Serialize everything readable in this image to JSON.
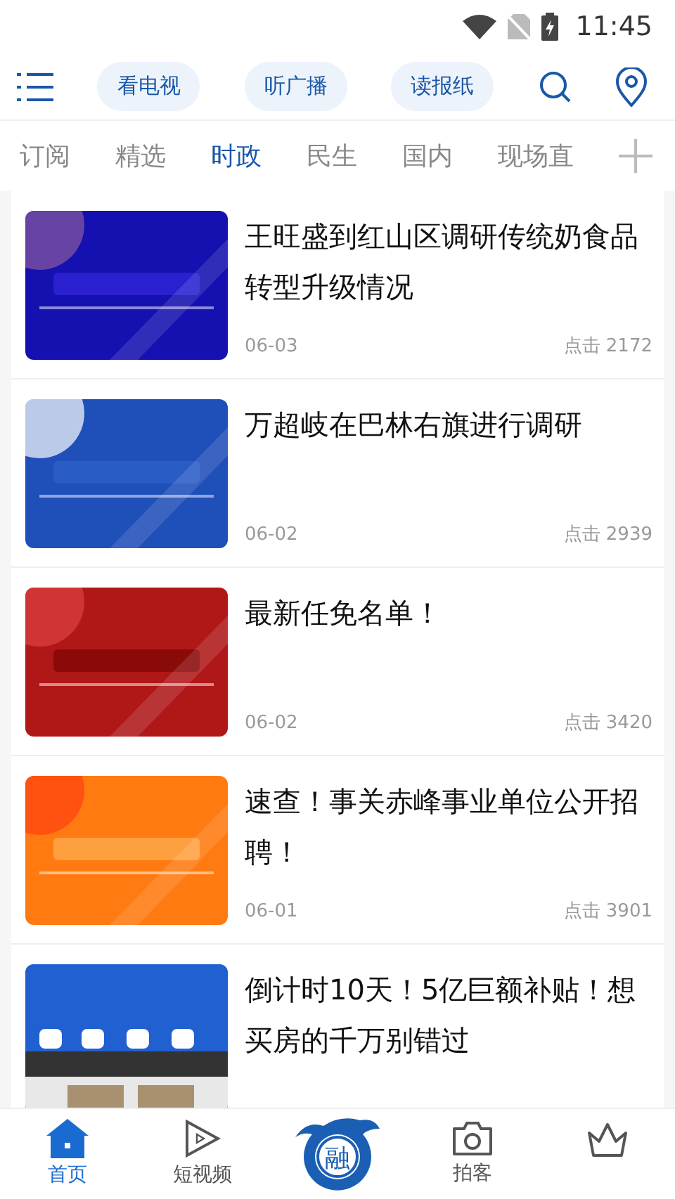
{
  "status_bar": {
    "time": "11:45"
  },
  "header": {
    "pills": [
      "看电视",
      "听广播",
      "读报纸"
    ]
  },
  "channels": [
    {
      "label": "订阅",
      "selected": false
    },
    {
      "label": "精选",
      "selected": false
    },
    {
      "label": "时政",
      "selected": true
    },
    {
      "label": "民生",
      "selected": false
    },
    {
      "label": "国内",
      "selected": false
    },
    {
      "label": "现场直",
      "selected": false
    }
  ],
  "articles": [
    {
      "title": "王旺盛到红山区调研传统奶食品转型升级情况",
      "date": "06-03",
      "clicks": "点击 2172"
    },
    {
      "title": "万超岐在巴林右旗进行调研",
      "date": "06-02",
      "clicks": "点击 2939"
    },
    {
      "title": "最新任免名单！",
      "date": "06-02",
      "clicks": "点击 3420"
    },
    {
      "title": "速查！事关赤峰事业单位公开招聘！",
      "date": "06-01",
      "clicks": "点击 3901"
    },
    {
      "title": "倒计时10天！5亿巨额补贴！想买房的千万别错过"
    }
  ],
  "bottom_nav": [
    {
      "kind": "home",
      "label": "首页",
      "selected": true
    },
    {
      "kind": "video",
      "label": "短视频",
      "selected": false
    },
    {
      "kind": "logo",
      "logo_text": "融"
    },
    {
      "kind": "camera",
      "label": "拍客",
      "selected": false
    },
    {
      "kind": "crown",
      "selected": false
    }
  ]
}
